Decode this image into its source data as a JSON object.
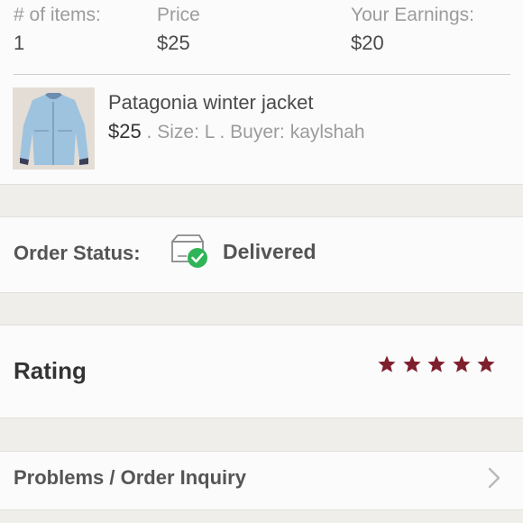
{
  "summary": {
    "items_label": "# of items:",
    "items_value": "1",
    "price_label": "Price",
    "price_value": "$25",
    "earnings_label": "Your Earnings:",
    "earnings_value": "$20"
  },
  "item": {
    "title": "Patagonia winter jacket",
    "price": "$25",
    "separator": " . ",
    "size": "Size: L",
    "buyer": "Buyer: kaylshah",
    "thumbnail_icon": "jacket-photo"
  },
  "order_status": {
    "label": "Order Status:",
    "value": "Delivered",
    "icon": "box-check-icon"
  },
  "rating": {
    "label": "Rating",
    "stars": 5,
    "max_stars": 5,
    "star_color": "#7e1f2d"
  },
  "problems": {
    "label": "Problems / Order Inquiry",
    "icon": "chevron-right-icon"
  }
}
